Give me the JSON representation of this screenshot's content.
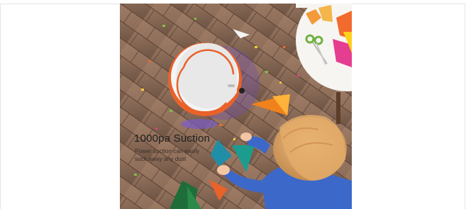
{
  "banner": {
    "headline": "1000pa Suction",
    "subtext": "Power suction can easily suck away any dust"
  },
  "colors": {
    "floor": "#8a6a55",
    "robot_accent": "#e8622a",
    "brush": "#6a4bb0"
  },
  "icons": {
    "product": "robot-vacuum",
    "tool": "scissors-icon"
  }
}
